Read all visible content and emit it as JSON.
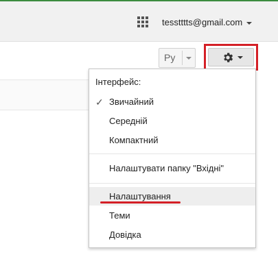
{
  "account": {
    "email": "tesstttts@gmail.com"
  },
  "toolbar": {
    "language_label": "Ру"
  },
  "settings_menu": {
    "header": "Інтерфейс:",
    "density": [
      {
        "label": "Звичайний",
        "checked": true
      },
      {
        "label": "Середній",
        "checked": false
      },
      {
        "label": "Компактний",
        "checked": false
      }
    ],
    "inbox_setup": "Налаштувати папку \"Вхідні\"",
    "settings": "Налаштування",
    "themes": "Теми",
    "help": "Довідка",
    "check_mark": "✓"
  },
  "colors": {
    "highlight": "#d41f26",
    "top_line": "#3b8c3f",
    "hover": "#eeeeee"
  },
  "icons": [
    "apps-grid-icon",
    "gear-icon",
    "chevron-down-icon",
    "check-icon"
  ]
}
